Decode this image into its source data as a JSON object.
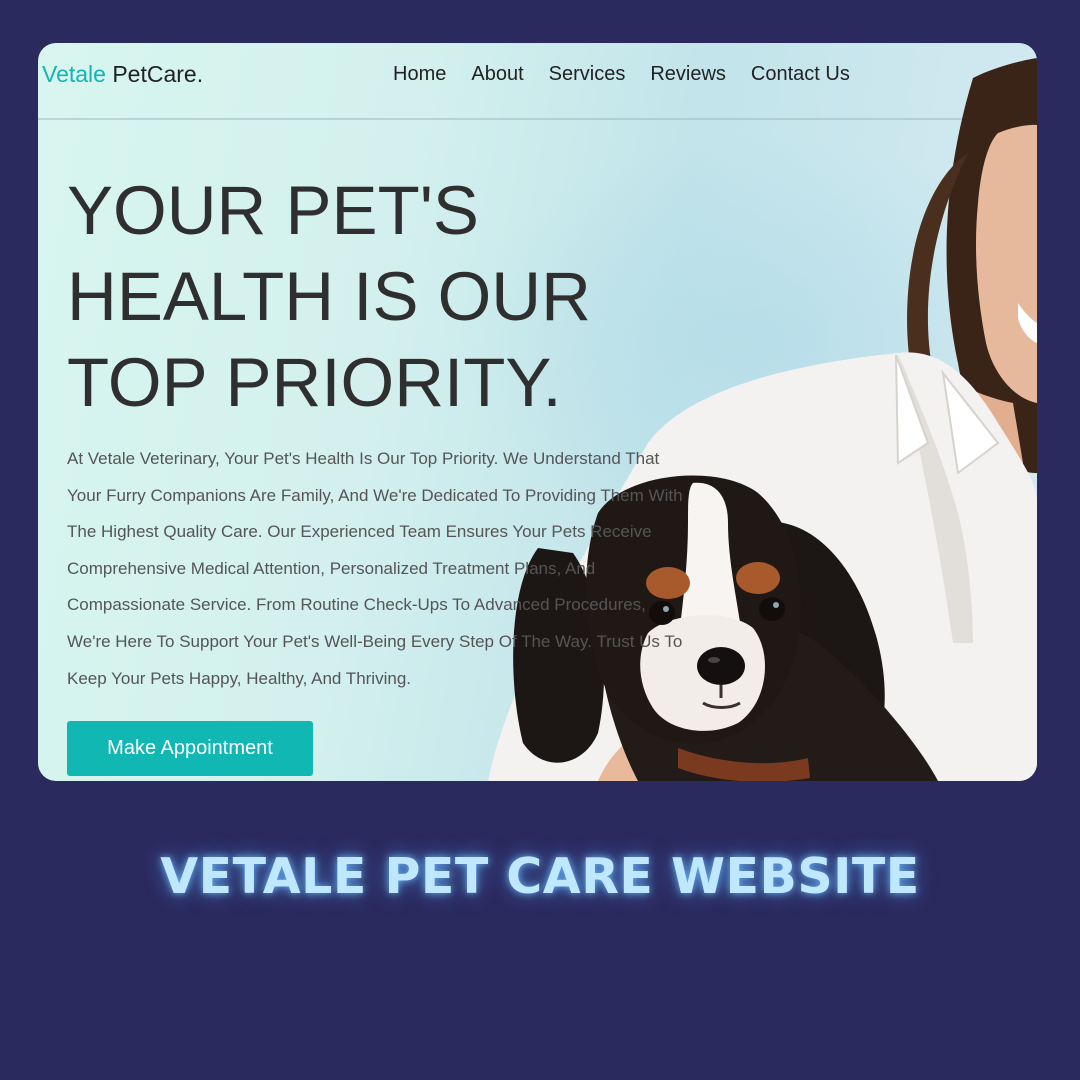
{
  "navbar": {
    "logo_accent": "Vetale",
    "logo_rest": " PetCare.",
    "links": [
      "Home",
      "About",
      "Services",
      "Reviews",
      "Contact Us"
    ]
  },
  "hero": {
    "title_line1": "YOUR PET'S",
    "title_line2": "HEALTH IS OUR",
    "title_line3": "TOP PRIORITY.",
    "description": "At Vetale Veterinary, Your Pet's Health Is Our Top Priority. We Understand That Your Furry Companions Are Family, And We're Dedicated To Providing Them With The Highest Quality Care. Our Experienced Team Ensures Your Pets Receive Comprehensive Medical Attention, Personalized Treatment Plans, And Compassionate Service. From Routine Check-Ups To Advanced Procedures, We're Here To Support Your Pet's Well-Being Every Step Of The Way. Trust Us To Keep Your Pets Happy, Healthy, And Thriving.",
    "button_label": "Make Appointment"
  },
  "caption": "VETALE PET CARE WEBSITE",
  "colors": {
    "background": "#2b2a5f",
    "accent": "#17b3b5",
    "button": "#10b7b3",
    "caption": "#bfe8ff"
  }
}
